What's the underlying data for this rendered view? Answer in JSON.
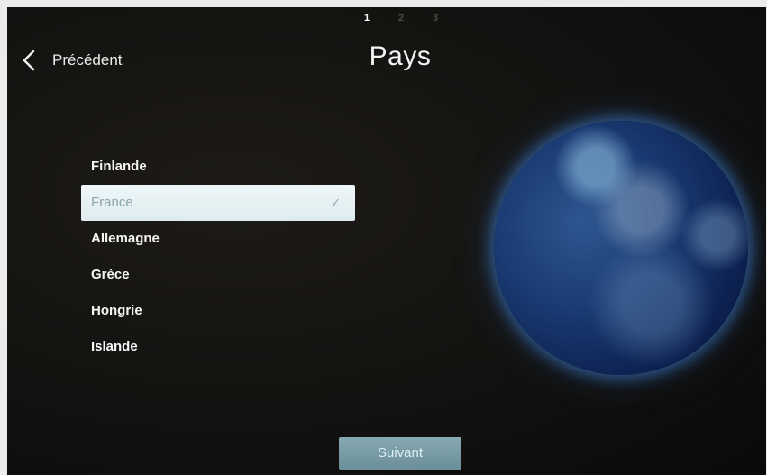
{
  "steps": [
    "1",
    "2",
    "3"
  ],
  "header": {
    "back_label": "Précédent",
    "title": "Pays"
  },
  "countries": [
    {
      "label": "Finlande",
      "selected": false
    },
    {
      "label": "France",
      "selected": true
    },
    {
      "label": "Allemagne",
      "selected": false
    },
    {
      "label": "Grèce",
      "selected": false
    },
    {
      "label": "Hongrie",
      "selected": false
    },
    {
      "label": "Islande",
      "selected": false
    }
  ],
  "check_mark": "✓",
  "icons": {
    "back": "chevron-left-icon",
    "selected": "check-icon",
    "illustration": "globe"
  },
  "next_label": "Suivant",
  "colors": {
    "background": "#131210",
    "selected_row": "#e6f0f3",
    "selected_text": "#8aa6b0",
    "next_button": "#7a9ca6"
  }
}
